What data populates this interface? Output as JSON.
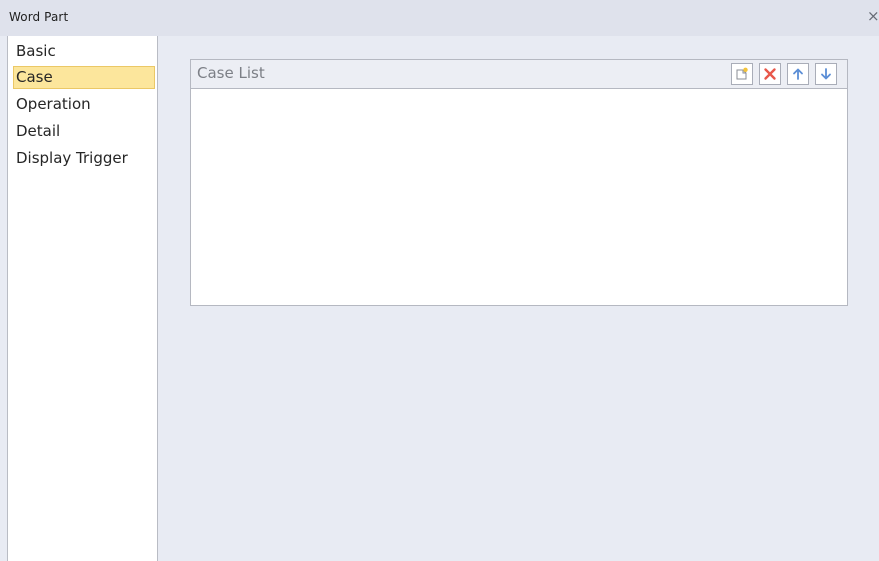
{
  "window": {
    "title": "Word Part",
    "close_symbol": "×"
  },
  "sidebar": {
    "items": [
      {
        "label": "Basic",
        "selected": false
      },
      {
        "label": "Case",
        "selected": true
      },
      {
        "label": "Operation",
        "selected": false
      },
      {
        "label": "Detail",
        "selected": false
      },
      {
        "label": "Display Trigger",
        "selected": false
      }
    ]
  },
  "case_list": {
    "title": "Case List",
    "toolbar": [
      {
        "icon": "new-item-icon"
      },
      {
        "icon": "delete-icon"
      },
      {
        "icon": "arrow-up-icon"
      },
      {
        "icon": "arrow-down-icon"
      }
    ],
    "rows": []
  },
  "colors": {
    "selected_bg": "#fce69c",
    "delete_red": "#e8574a",
    "arrow_blue": "#5b8ed6"
  }
}
